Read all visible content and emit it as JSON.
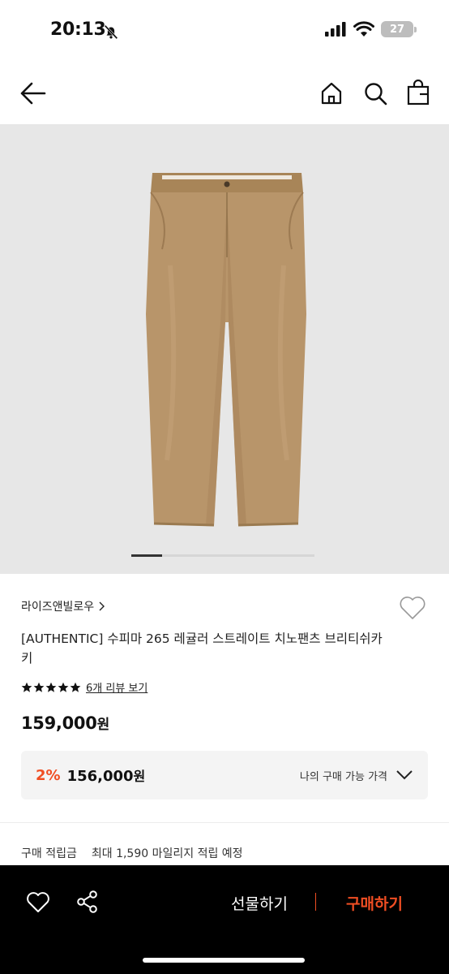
{
  "status": {
    "time": "20:13",
    "battery": "27"
  },
  "header": {
    "back": "back-icon",
    "home": "home-icon",
    "search": "search-icon",
    "bag": "shopping-bag-icon"
  },
  "product": {
    "brand": "라이즈앤빌로우",
    "title": "[AUTHENTIC] 수피마 265 레귤러 스트레이트 치노팬츠 브리티쉬카키",
    "rating_stars": 5,
    "review_link": "6개 리뷰 보기",
    "price": "159,000",
    "price_unit": "원",
    "my_price": {
      "rate": "2%",
      "value": "156,000",
      "unit": "원",
      "label": "나의 구매 가능 가격"
    },
    "points": {
      "label": "구매 적립금",
      "value": "최대 1,590 마일리지 적립 예정"
    }
  },
  "gallery": {
    "active_index": 0,
    "image_color": "#b89568"
  },
  "bottom_bar": {
    "gift_label": "선물하기",
    "buy_label": "구매하기"
  },
  "colors": {
    "accent": "#f04e23",
    "bar_bg": "#000000",
    "gallery_bg": "#e7e7e7"
  }
}
